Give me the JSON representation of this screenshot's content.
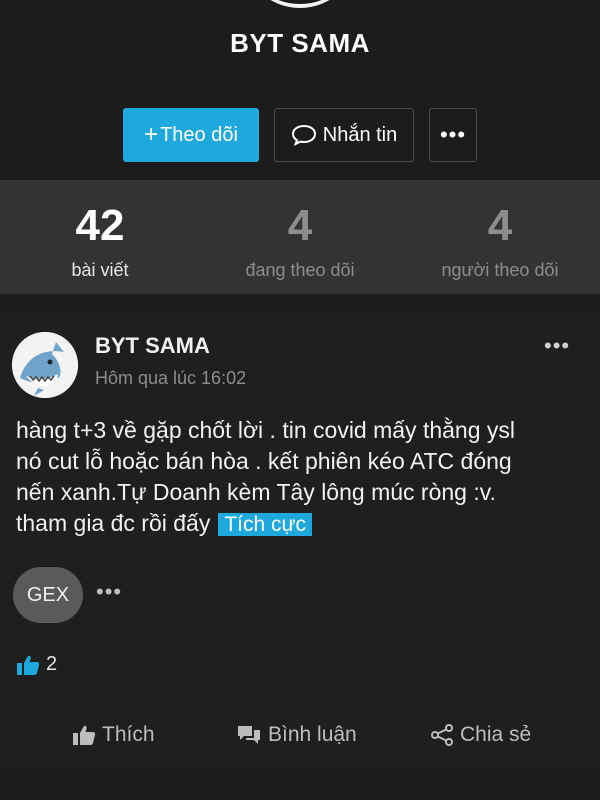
{
  "profile": {
    "name": "BYT SAMA",
    "follow_label": "Theo dõi",
    "message_label": "Nhắn tin",
    "more_label": "•••"
  },
  "stats": [
    {
      "count": "42",
      "label": "bài viết"
    },
    {
      "count": "4",
      "label": "đang theo dõi"
    },
    {
      "count": "4",
      "label": "người theo dõi"
    }
  ],
  "post": {
    "author": "BYT SAMA",
    "time": "Hôm qua lúc 16:02",
    "menu_label": "•••",
    "lines": [
      "hàng t+3 về gặp chốt lời . tin covid mấy thằng ysl",
      "nó cut lỗ hoặc bán hòa  . kết phiên kéo ATC đóng",
      "nến xanh.Tự Doanh kèm Tây lông múc ròng :v.",
      "tham gia đc rồi đấy"
    ],
    "sentiment": "Tích cực",
    "ticker": "GEX",
    "ticker_more": "•••",
    "like_count": "2",
    "actions": {
      "like": "Thích",
      "comment": "Bình luận",
      "share": "Chia sẻ"
    }
  },
  "colors": {
    "accent": "#1fa8dc",
    "stats_bg": "#333333",
    "card_bg": "#1f1f1f"
  },
  "icons": {
    "follow": "plus-icon",
    "message": "speech-bubble-icon",
    "like": "thumbs-up-icon",
    "comment": "chat-bubbles-icon",
    "share": "share-icon"
  }
}
